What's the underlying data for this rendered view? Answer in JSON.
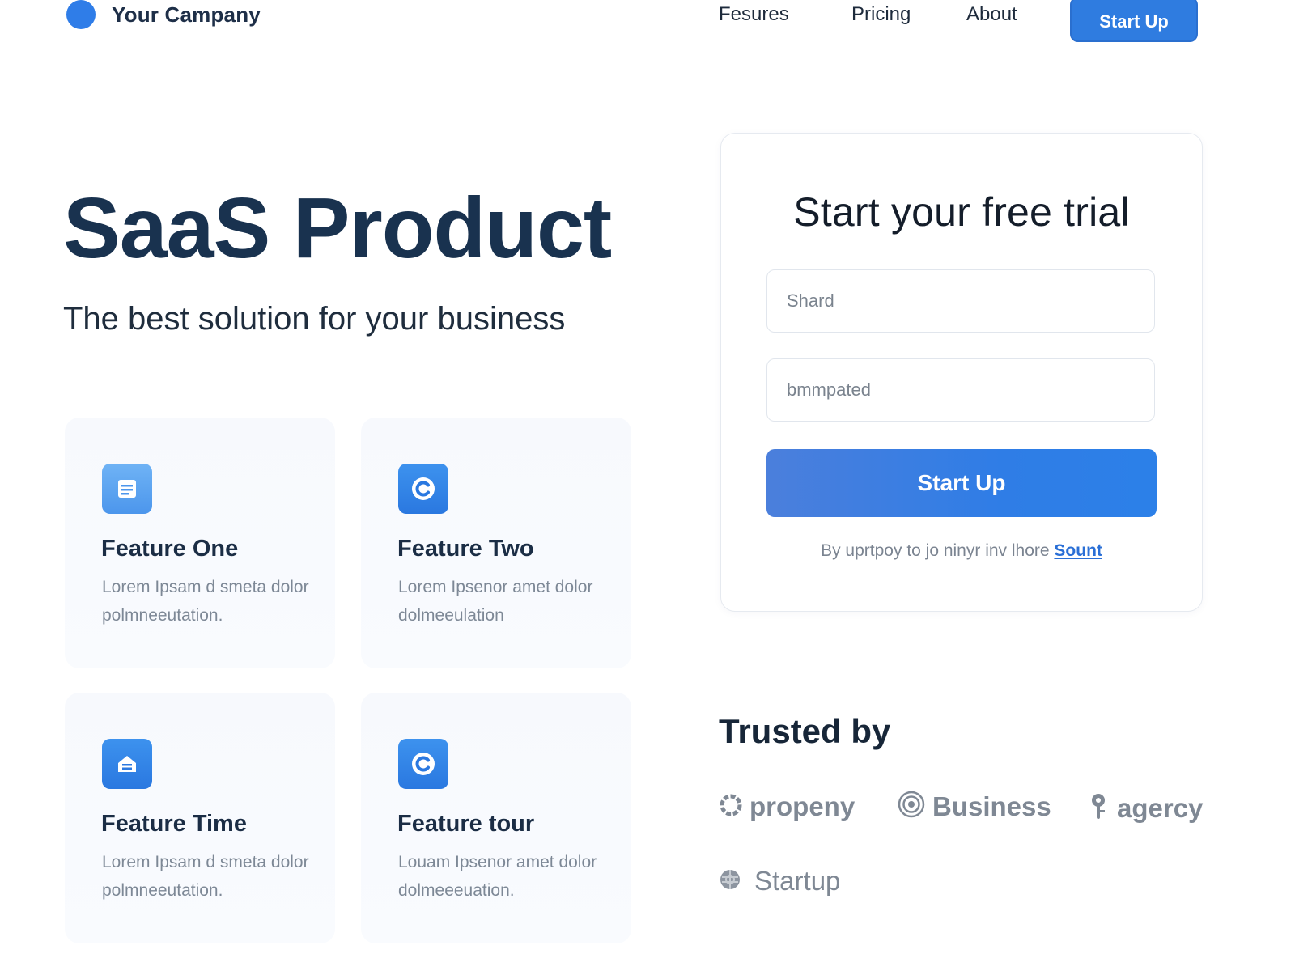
{
  "header": {
    "company": "Your Campany",
    "nav": [
      "Fesures",
      "Pricing",
      "About"
    ],
    "cta": "Start Up"
  },
  "hero": {
    "title": "SaaS Product",
    "subtitle": "The best solution for your business"
  },
  "features": [
    {
      "title": "Feature One",
      "desc": "Lorem Ipsam d smeta dolor polmneeutation.",
      "icon": "document-icon"
    },
    {
      "title": "Feature Two",
      "desc": "Lorem Ipsenor amet dolor dolmeeulation",
      "icon": "refresh-icon"
    },
    {
      "title": "Feature Time",
      "desc": "Lorem Ipsam d smeta dolor polmneeutation.",
      "icon": "inbox-icon"
    },
    {
      "title": "Feature tour",
      "desc": "Louam Ipsenor amet dolor dolmeeeuation.",
      "icon": "refresh-icon"
    }
  ],
  "trial": {
    "title": "Start your free trial",
    "input1_placeholder": "Shard",
    "input2_placeholder": "bmmpated",
    "submit": "Start Up",
    "terms_prefix": "By uprtpoy to jo ninyr inv lhore",
    "terms_link": "Sount"
  },
  "trusted": {
    "title": "Trusted by",
    "brands": [
      {
        "name": "propeny",
        "icon": "ring-icon"
      },
      {
        "name": "Business",
        "icon": "swirl-icon"
      },
      {
        "name": "agercy",
        "icon": "pin-icon"
      },
      {
        "name": "Startup",
        "icon": "globe-icon"
      }
    ]
  },
  "colors": {
    "accent": "#2f7de8",
    "heading": "#19324f",
    "muted": "#7f8894"
  }
}
